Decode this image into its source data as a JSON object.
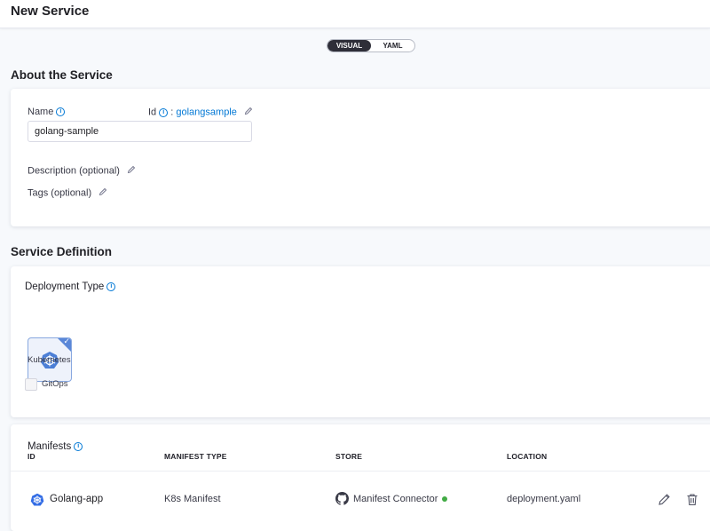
{
  "header": {
    "title": "New Service"
  },
  "view_toggle": {
    "options": [
      "VISUAL",
      "YAML"
    ],
    "active": "VISUAL"
  },
  "about": {
    "title": "About the Service",
    "name_label": "Name",
    "id_label": "Id",
    "id_separator": ":",
    "id_value": "golangsample",
    "name_value": "golang-sample",
    "description_label": "Description (optional)",
    "tags_label": "Tags (optional)"
  },
  "service_definition": {
    "title": "Service Definition",
    "deployment_type_label": "Deployment Type",
    "selected_type": "Kubernetes",
    "gitops_label": "GitOps",
    "gitops_checked": false
  },
  "manifests": {
    "title": "Manifests",
    "columns": [
      "ID",
      "MANIFEST TYPE",
      "STORE",
      "LOCATION"
    ],
    "rows": [
      {
        "id": "Golang-app",
        "type": "K8s Manifest",
        "store": "Manifest Connector",
        "store_status": "connected",
        "location": "deployment.yaml"
      }
    ]
  },
  "colors": {
    "accent": "#0278d5",
    "status_ok": "#42ab45",
    "toggle_active": "#2e2e38"
  }
}
